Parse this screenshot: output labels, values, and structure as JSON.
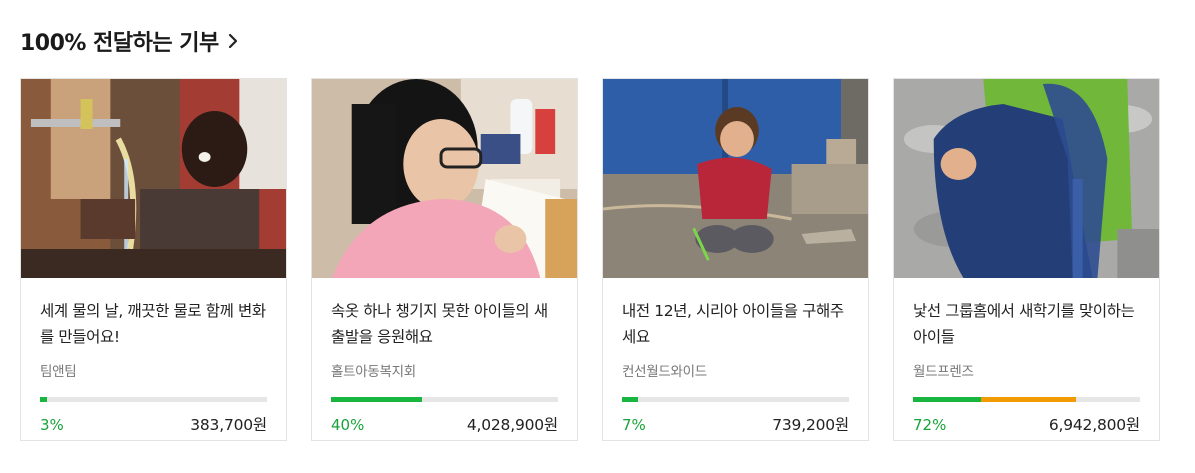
{
  "section": {
    "title": "100% 전달하는 기부"
  },
  "icons": {
    "more": "chevron-right-icon"
  },
  "colors": {
    "progress_green": "#19b63f",
    "progress_orange": "#f19b00",
    "percent_text": "#18a339"
  },
  "cards": [
    {
      "title": "세계 물의 날, 깨끗한 물로 함께 변화를 만들어요!",
      "organization": "팀앤팀",
      "percent_label": "3%",
      "progress": 3,
      "amount": "383,700원",
      "image": "child-at-water-tap"
    },
    {
      "title": "속옷 하나 챙기지 못한 아이들의 새출발을 응원해요",
      "organization": "홀트아동복지회",
      "percent_label": "40%",
      "progress": 40,
      "amount": "4,028,900원",
      "image": "child-drawing-at-desk"
    },
    {
      "title": "내전 12년, 시리아 아이들을 구해주세요",
      "organization": "컨선월드와이드",
      "percent_label": "7%",
      "progress": 7,
      "amount": "739,200원",
      "image": "child-crouching-on-ground"
    },
    {
      "title": "낯선 그룹홈에서 새학기를 맞이하는 아이들",
      "organization": "월드프렌즈",
      "percent_label": "72%",
      "progress": 72,
      "progress_split": [
        30,
        42
      ],
      "amount": "6,942,800원",
      "image": "child-with-backpack"
    }
  ]
}
